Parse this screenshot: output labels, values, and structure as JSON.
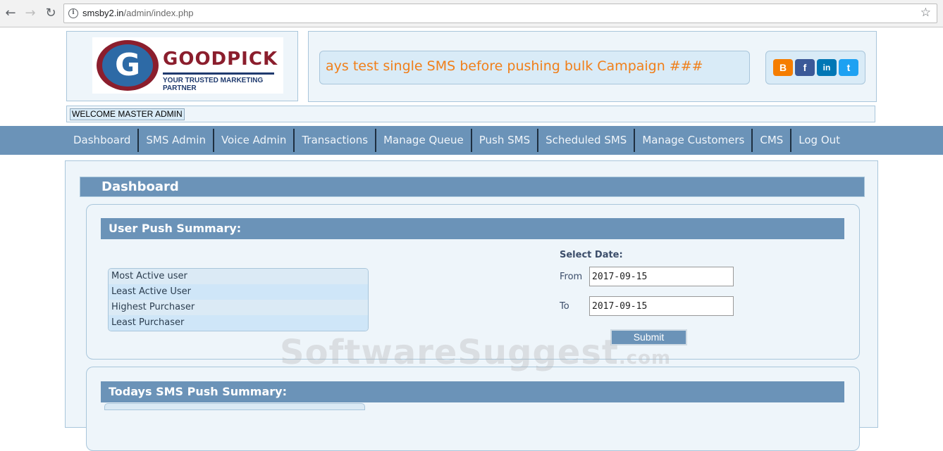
{
  "browser": {
    "url_host": "smsby2.in",
    "url_path": "/admin/index.php",
    "icons": [
      "back-arrow-icon",
      "forward-arrow-icon",
      "reload-icon",
      "info-icon",
      "star-icon"
    ]
  },
  "header": {
    "logo_name": "GOODPICK",
    "logo_tagline": "YOUR TRUSTED MARKETING PARTNER",
    "ticker_text": "ays test single SMS before pushing bulk Campaign ###",
    "social": [
      "blogger-icon",
      "facebook-icon",
      "linkedin-icon",
      "twitter-icon"
    ],
    "welcome": "WELCOME MASTER ADMIN"
  },
  "menu": [
    "Dashboard",
    "SMS Admin",
    "Voice Admin",
    "Transactions",
    "Manage Queue",
    "Push SMS",
    "Scheduled SMS",
    "Manage Customers",
    "CMS",
    "Log Out"
  ],
  "main": {
    "title": "Dashboard",
    "user_push": {
      "title": "User Push Summary:",
      "items": [
        "Most Active user",
        "Least Active User",
        "Highest Purchaser",
        "Least Purchaser"
      ],
      "select_date_label": "Select Date:",
      "from_label": "From",
      "from_value": "2017-09-15",
      "to_label": "To",
      "to_value": "2017-09-15",
      "submit_label": "Submit"
    },
    "todays_push": {
      "title": "Todays SMS Push Summary:"
    }
  },
  "watermark": {
    "main": "SoftwareSuggest",
    "suffix": ".com"
  },
  "colors": {
    "nav_blue": "#6b93b8",
    "ticker_orange": "#f07f1a",
    "panel_bg": "#eef5fa"
  }
}
